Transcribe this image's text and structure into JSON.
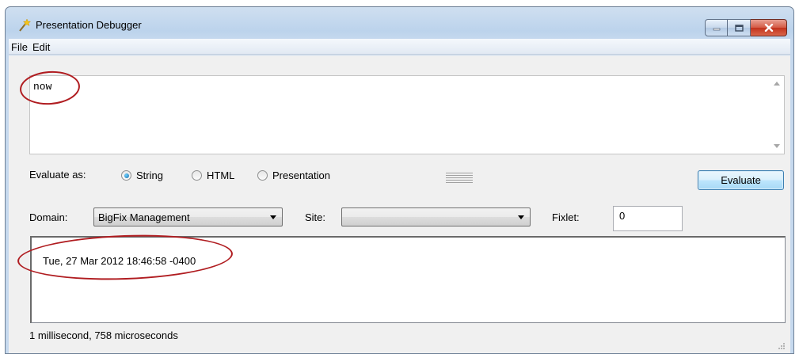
{
  "window": {
    "title": "Presentation Debugger",
    "controls": {
      "minimize": "minimize-icon",
      "maximize": "maximize-icon",
      "close": "close-icon"
    }
  },
  "menu": [
    "File",
    "Edit"
  ],
  "expression": {
    "value": "now"
  },
  "evaluate_as": {
    "label": "Evaluate as:",
    "options": [
      {
        "label": "String",
        "selected": true
      },
      {
        "label": "HTML",
        "selected": false
      },
      {
        "label": "Presentation",
        "selected": false
      }
    ]
  },
  "evaluate_button": "Evaluate",
  "domain": {
    "label": "Domain:",
    "value": "BigFix Management"
  },
  "site": {
    "label": "Site:",
    "value": ""
  },
  "fixlet": {
    "label": "Fixlet:",
    "value": "0"
  },
  "output": {
    "text": "Tue, 27 Mar 2012 18:46:58 -0400"
  },
  "status": {
    "text": "1 millisecond, 758 microseconds"
  },
  "colors": {
    "annotation": "#b01c20",
    "evaluate_border": "#3c7fb1",
    "close_button": "#c2321c"
  }
}
